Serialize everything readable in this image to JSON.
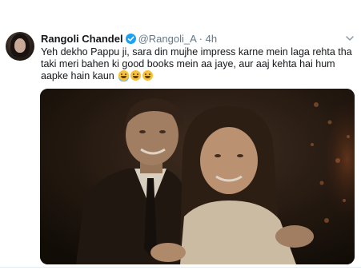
{
  "tweet": {
    "display_name": "Rangoli Chandel",
    "handle": "@Rangoli_A",
    "separator": "·",
    "time": "4h",
    "text": "Yeh dekho Pappu ji, sara din mujhe impress karne mein laga rehta tha taki meri bahen ki good books mein aa jaye, aur aaj kehta hai hum aapke hain kaun",
    "emojis": [
      "face-with-tears-of-joy",
      "grinning-face",
      "grinning-face"
    ]
  },
  "icons": {
    "verified": "verified-badge-icon",
    "more": "chevron-down-icon"
  },
  "colors": {
    "verified_blue": "#1da1f2",
    "text": "#14171a",
    "secondary": "#657786"
  }
}
